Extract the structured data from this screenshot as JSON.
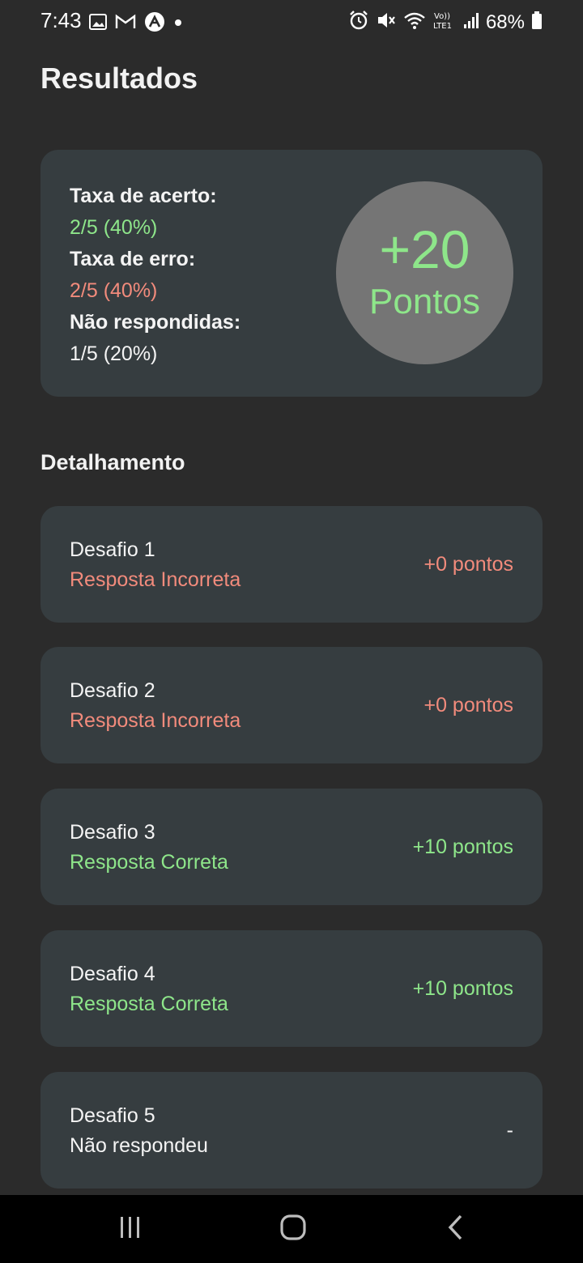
{
  "status_bar": {
    "time": "7:43",
    "battery": "68%",
    "icons_left": [
      "image-icon",
      "gmail-icon",
      "app-icon",
      "dot-icon"
    ],
    "icons_right": [
      "alarm-icon",
      "mute-icon",
      "wifi-icon",
      "volte-icon",
      "signal-icon",
      "battery-icon"
    ]
  },
  "header": {
    "title": "Resultados"
  },
  "summary": {
    "hit_label": "Taxa de acerto:",
    "hit_value": "2/5 (40%)",
    "error_label": "Taxa de erro:",
    "error_value": "2/5 (40%)",
    "unanswered_label": "Não respondidas:",
    "unanswered_value": "1/5 (20%)",
    "score_value": "+20",
    "score_unit": "Pontos"
  },
  "details": {
    "title": "Detalhamento",
    "items": [
      {
        "name": "Desafio 1",
        "status": "Resposta Incorreta",
        "points": "+0 pontos",
        "result": "incorrect"
      },
      {
        "name": "Desafio 2",
        "status": "Resposta Incorreta",
        "points": "+0 pontos",
        "result": "incorrect"
      },
      {
        "name": "Desafio 3",
        "status": "Resposta Correta",
        "points": "+10 pontos",
        "result": "correct"
      },
      {
        "name": "Desafio 4",
        "status": "Resposta Correta",
        "points": "+10 pontos",
        "result": "correct"
      },
      {
        "name": "Desafio 5",
        "status": "Não respondeu",
        "points": "-",
        "result": "unanswered"
      }
    ]
  },
  "colors": {
    "background": "#2b2b2b",
    "card": "#363d40",
    "correct": "#8ee68a",
    "incorrect": "#f28b7c",
    "score_circle": "#757575"
  },
  "nav_bar": {
    "buttons": [
      "recents-icon",
      "home-icon",
      "back-icon"
    ]
  }
}
